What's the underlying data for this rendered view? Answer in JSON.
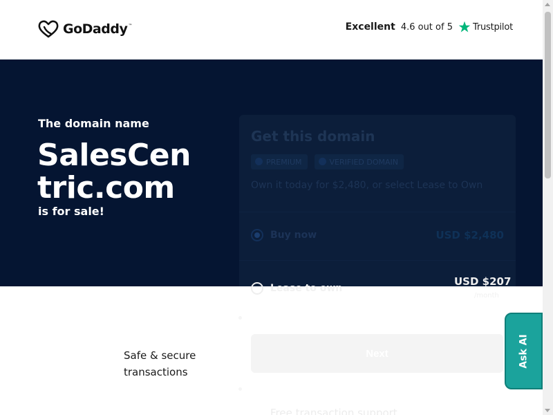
{
  "header": {
    "logo_text": "GoDaddy",
    "logo_tm": "™",
    "trustpilot": {
      "rating_word": "Excellent",
      "score": "4.6 out of 5",
      "brand": "Trustpilot"
    }
  },
  "hero": {
    "pre_text": "The domain name",
    "domain": "SalesCentric.com",
    "post_text": "is for sale!"
  },
  "card": {
    "title": "Get this domain",
    "badges": [
      "PREMIUM",
      "VERIFIED DOMAIN"
    ],
    "subtitle": "Own it today for $2,480, or select Lease to Own",
    "options": [
      {
        "label": "Buy now",
        "price": "USD $2,480",
        "selected": true
      },
      {
        "label": "Lease to own",
        "price": "USD $207",
        "unit": "/month",
        "selected": false
      }
    ],
    "next_label": "Next",
    "support_text": "Free transaction support"
  },
  "lower": {
    "secure_text": "Safe & secure transactions"
  },
  "ask_ai": {
    "label": "Ask AI"
  },
  "colors": {
    "hero_bg": "#051532",
    "trustpilot_green": "#00b67a",
    "ask_ai_bg": "#1ba39c"
  }
}
